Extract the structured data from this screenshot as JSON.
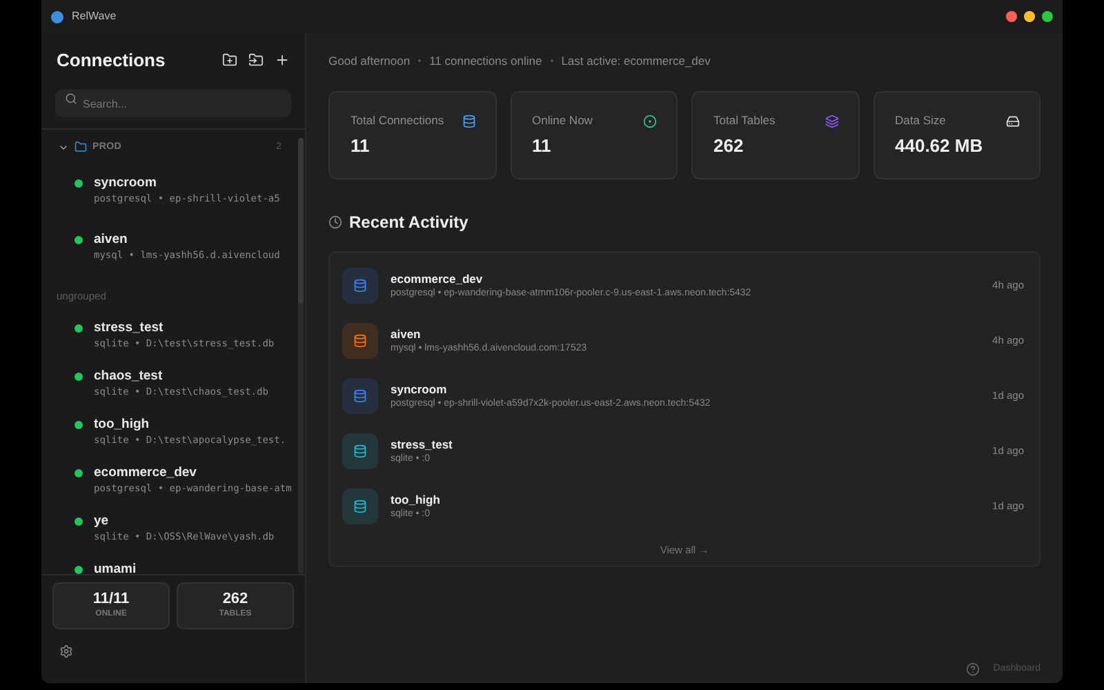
{
  "window": {
    "title": "RelWave"
  },
  "sidebar": {
    "title": "Connections",
    "search": {
      "placeholder": "Search..."
    },
    "groups": [
      {
        "name": "PROD",
        "count": "2",
        "expanded": true,
        "items": [
          {
            "name": "syncroom",
            "detail": "postgresql • ep-shrill-violet-a5",
            "online": true
          },
          {
            "name": "aiven",
            "detail": "mysql • lms-yashh56.d.aivencloud",
            "online": true
          }
        ]
      }
    ],
    "ungrouped_label": "ungrouped",
    "items": [
      {
        "name": "stress_test",
        "detail": "sqlite • D:\\test\\stress_test.db",
        "online": true
      },
      {
        "name": "chaos_test",
        "detail": "sqlite • D:\\test\\chaos_test.db",
        "online": true
      },
      {
        "name": "too_high",
        "detail": "sqlite • D:\\test\\apocalypse_test.",
        "online": true
      },
      {
        "name": "ecommerce_dev",
        "detail": "postgresql • ep-wandering-base-atm",
        "online": true
      },
      {
        "name": "ye",
        "detail": "sqlite • D:\\OSS\\RelWave\\yash.db",
        "online": true
      },
      {
        "name": "umami",
        "online": true
      }
    ],
    "stats": [
      {
        "value": "11/11",
        "label": "ONLINE"
      },
      {
        "value": "262",
        "label": "TABLES"
      }
    ]
  },
  "header": {
    "parts": [
      "Good afternoon",
      "11 connections online",
      "Last active: ecommerce_dev"
    ]
  },
  "cards": [
    {
      "label": "Total Connections",
      "value": "11",
      "kind": "database",
      "color": "#4f9ee8"
    },
    {
      "label": "Online Now",
      "value": "11",
      "kind": "pulse",
      "color": "#2ecc8f"
    },
    {
      "label": "Total Tables",
      "value": "262",
      "kind": "layers",
      "color": "#8b5cf6"
    },
    {
      "label": "Data Size",
      "value": "440.62 MB",
      "kind": "drive",
      "color": "#e5e5e5"
    }
  ],
  "recent": {
    "title": "Recent Activity",
    "items": [
      {
        "name": "ecommerce_dev",
        "detail": "postgresql • ep-wandering-base-atmm106r-pooler.c-9.us-east-1.aws.neon.tech:5432",
        "time": "4h ago",
        "color": "#3b82f6"
      },
      {
        "name": "aiven",
        "detail": "mysql • lms-yashh56.d.aivencloud.com:17523",
        "time": "4h ago",
        "color": "#f97316"
      },
      {
        "name": "syncroom",
        "detail": "postgresql • ep-shrill-violet-a59d7x2k-pooler.us-east-2.aws.neon.tech:5432",
        "time": "1d ago",
        "color": "#3b82f6"
      },
      {
        "name": "stress_test",
        "detail": "sqlite • :0",
        "time": "1d ago",
        "color": "#22b8d8"
      },
      {
        "name": "too_high",
        "detail": "sqlite • :0",
        "time": "1d ago",
        "color": "#22b8d8"
      }
    ],
    "view_all": "View all →"
  },
  "status_bar": {
    "page": "Dashboard"
  }
}
